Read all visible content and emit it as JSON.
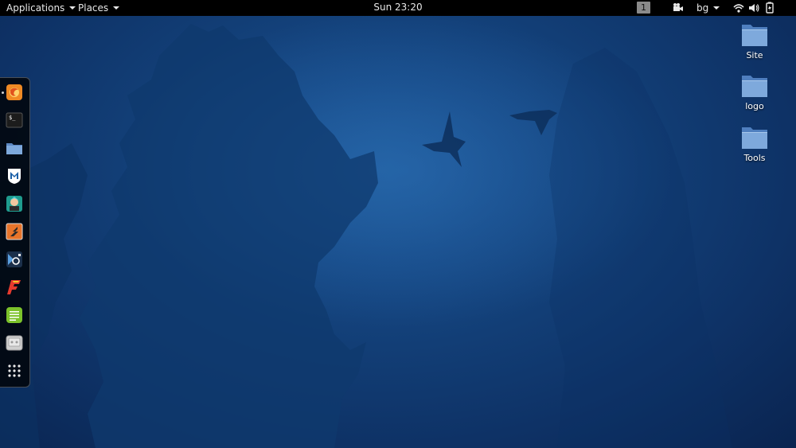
{
  "topbar": {
    "applications_label": "Applications",
    "places_label": "Places",
    "clock": "Sun 23:20",
    "workspace_number": "1",
    "user_label": "bg"
  },
  "dock": {
    "items": [
      {
        "icon": "firefox-icon"
      },
      {
        "icon": "terminal-icon"
      },
      {
        "icon": "files-icon"
      },
      {
        "icon": "metasploit-icon"
      },
      {
        "icon": "armitage-icon"
      },
      {
        "icon": "burpsuite-icon"
      },
      {
        "icon": "maltego-icon"
      },
      {
        "icon": "faraday-icon"
      },
      {
        "icon": "leafpad-icon"
      },
      {
        "icon": "cutycapt-icon"
      },
      {
        "icon": "show-applications-icon"
      }
    ]
  },
  "desktop": {
    "icons": [
      {
        "label": "Site",
        "icon": "folder-icon"
      },
      {
        "label": "logo",
        "icon": "folder-icon"
      },
      {
        "label": "Tools",
        "icon": "folder-icon"
      }
    ]
  },
  "colors": {
    "wallpaper": "#123e76",
    "topbar": "#000000",
    "folder": "#6f9fd8"
  }
}
